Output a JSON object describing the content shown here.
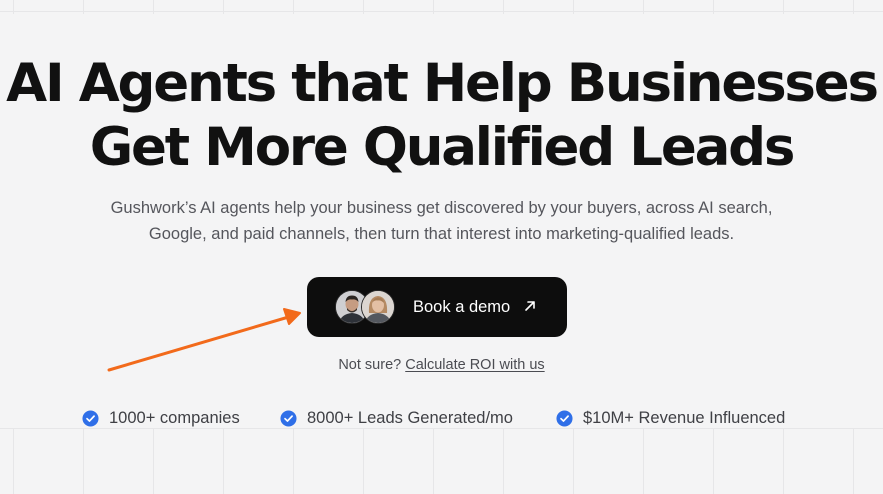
{
  "hero": {
    "headline_line1": "AI Agents that Help Businesses",
    "headline_line2": "Get More Qualified Leads",
    "subtext": "Gushwork’s AI agents help your business get discovered by your buyers, across AI search, Google, and paid channels, then turn that interest into marketing-qualified leads."
  },
  "cta": {
    "label": "Book a demo",
    "icon": "arrow-up-right-icon",
    "avatars": [
      "avatar-man",
      "avatar-woman"
    ]
  },
  "roi": {
    "prefix": "Not sure?",
    "link_label": "Calculate ROI with us"
  },
  "stats": [
    {
      "label": "1000+ companies",
      "icon": "check-badge-icon"
    },
    {
      "label": "8000+ Leads Generated/mo",
      "icon": "check-badge-icon"
    },
    {
      "label": "$10M+ Revenue Influenced",
      "icon": "check-badge-icon"
    }
  ],
  "colors": {
    "background": "#f4f4f5",
    "button": "#0d0d0d",
    "check": "#2f6fe8",
    "annotation_arrow": "#f26a1b"
  }
}
